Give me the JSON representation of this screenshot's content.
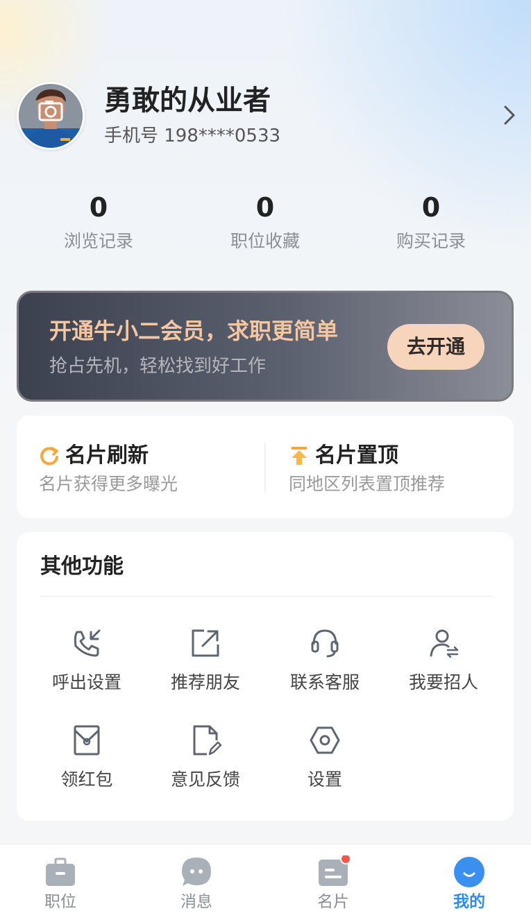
{
  "profile": {
    "name": "勇敢的从业者",
    "phone": "手机号 198****0533"
  },
  "stats": [
    {
      "value": "0",
      "label": "浏览记录"
    },
    {
      "value": "0",
      "label": "职位收藏"
    },
    {
      "value": "0",
      "label": "购买记录"
    }
  ],
  "vip": {
    "title": "开通牛小二会员，求职更简单",
    "subtitle": "抢占先机，轻松找到好工作",
    "button": "去开通"
  },
  "promo": [
    {
      "title": "名片刷新",
      "desc": "名片获得更多曝光",
      "icon": "refresh-icon"
    },
    {
      "title": "名片置顶",
      "desc": "同地区列表置顶推荐",
      "icon": "pin-top-icon"
    }
  ],
  "other": {
    "title": "其他功能",
    "items": [
      {
        "label": "呼出设置",
        "icon": "phone-outgoing-icon"
      },
      {
        "label": "推荐朋友",
        "icon": "share-icon"
      },
      {
        "label": "联系客服",
        "icon": "headset-icon"
      },
      {
        "label": "我要招人",
        "icon": "recruit-icon"
      },
      {
        "label": "领红包",
        "icon": "red-packet-icon"
      },
      {
        "label": "意见反馈",
        "icon": "feedback-icon"
      },
      {
        "label": "设置",
        "icon": "settings-icon"
      }
    ]
  },
  "tabbar": {
    "tabs": [
      {
        "label": "职位",
        "icon": "briefcase-icon"
      },
      {
        "label": "消息",
        "icon": "message-icon"
      },
      {
        "label": "名片",
        "icon": "card-icon"
      },
      {
        "label": "我的",
        "icon": "smile-icon"
      }
    ],
    "active": "我的"
  },
  "colors": {
    "accent": "#2d8ef0",
    "vip_title": "#f4c6a1",
    "vip_button": "#f7d5bd",
    "badge": "#f5574c",
    "icon_gray": "#5d6570"
  }
}
